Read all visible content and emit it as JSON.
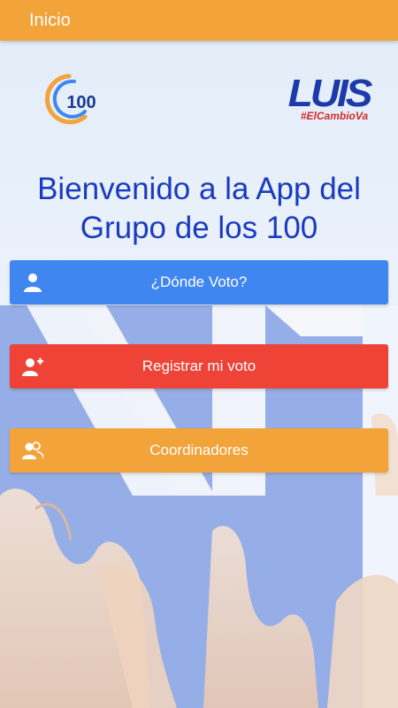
{
  "topbar": {
    "title": "Inicio"
  },
  "logos": {
    "group_number": "100",
    "candidate_name": "LUIS",
    "candidate_hashtag": "#ElCambioVa"
  },
  "welcome": {
    "line1": "Bienvenido a la App del",
    "line2": "Grupo de los 100"
  },
  "buttons": [
    {
      "label": "¿Dónde Voto?",
      "icon": "user-icon",
      "color": "#3f86f1"
    },
    {
      "label": "Registrar mi voto",
      "icon": "user-plus-icon",
      "color": "#ee4336"
    },
    {
      "label": "Coordinadores",
      "icon": "users-icon",
      "color": "#f2a33a"
    }
  ],
  "colors": {
    "topbar": "#f2a33a",
    "heading": "#1a3bbf",
    "background_panel": "#96aee8"
  }
}
